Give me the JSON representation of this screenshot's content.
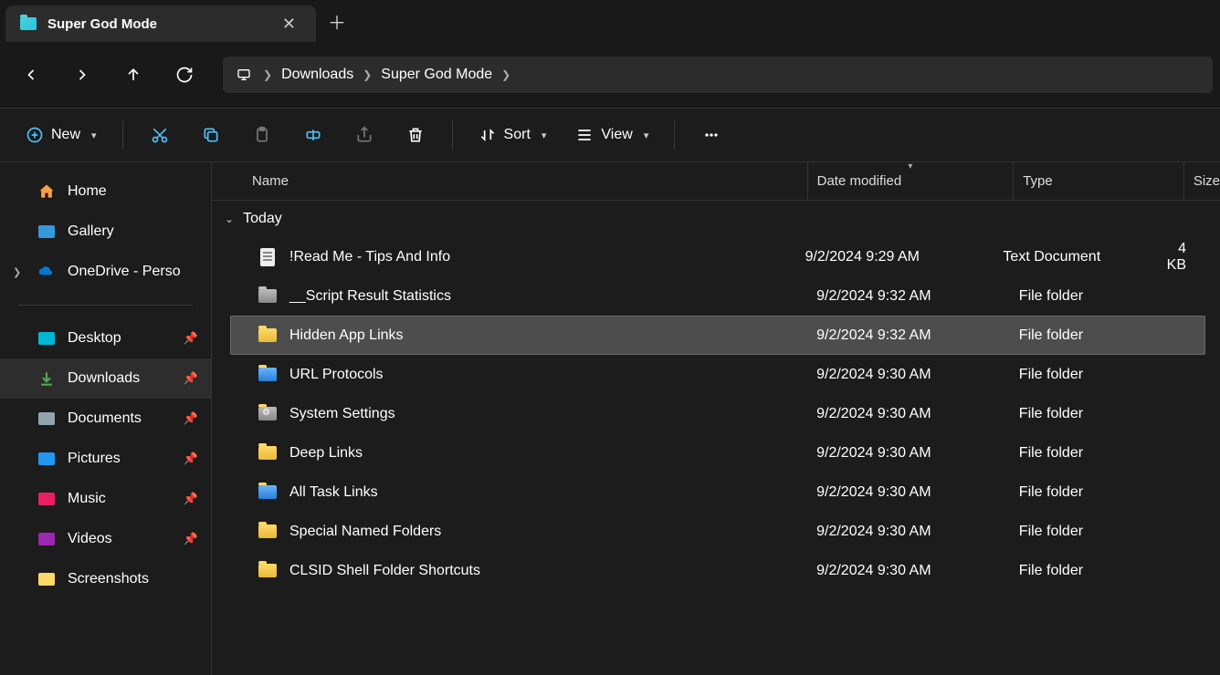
{
  "tab": {
    "title": "Super God Mode"
  },
  "breadcrumb": {
    "parts": [
      "Downloads",
      "Super God Mode"
    ]
  },
  "toolbar": {
    "new_label": "New",
    "sort_label": "Sort",
    "view_label": "View"
  },
  "columns": {
    "name": "Name",
    "date": "Date modified",
    "type": "Type",
    "size": "Size"
  },
  "sidebar": {
    "top": [
      {
        "label": "Home",
        "icon": "home"
      },
      {
        "label": "Gallery",
        "icon": "gallery"
      },
      {
        "label": "OneDrive - Perso",
        "icon": "onedrive",
        "expandable": true
      }
    ],
    "quick": [
      {
        "label": "Desktop",
        "icon": "desktop",
        "pinned": true
      },
      {
        "label": "Downloads",
        "icon": "downloads",
        "pinned": true,
        "selected": true
      },
      {
        "label": "Documents",
        "icon": "documents",
        "pinned": true
      },
      {
        "label": "Pictures",
        "icon": "pictures",
        "pinned": true
      },
      {
        "label": "Music",
        "icon": "music",
        "pinned": true
      },
      {
        "label": "Videos",
        "icon": "videos",
        "pinned": true
      },
      {
        "label": "Screenshots",
        "icon": "folder",
        "pinned": false
      }
    ]
  },
  "group": {
    "label": "Today"
  },
  "files": [
    {
      "name": "!Read Me - Tips And Info",
      "date": "9/2/2024 9:29 AM",
      "type": "Text Document",
      "size": "4 KB",
      "icon": "text"
    },
    {
      "name": "__Script Result Statistics",
      "date": "9/2/2024 9:32 AM",
      "type": "File folder",
      "size": "",
      "icon": "folder-gray"
    },
    {
      "name": "Hidden App Links",
      "date": "9/2/2024 9:32 AM",
      "type": "File folder",
      "size": "",
      "icon": "folder",
      "selected": true
    },
    {
      "name": "URL Protocols",
      "date": "9/2/2024 9:30 AM",
      "type": "File folder",
      "size": "",
      "icon": "folder-blue"
    },
    {
      "name": "System Settings",
      "date": "9/2/2024 9:30 AM",
      "type": "File folder",
      "size": "",
      "icon": "folder-gear"
    },
    {
      "name": "Deep Links",
      "date": "9/2/2024 9:30 AM",
      "type": "File folder",
      "size": "",
      "icon": "folder"
    },
    {
      "name": "All Task Links",
      "date": "9/2/2024 9:30 AM",
      "type": "File folder",
      "size": "",
      "icon": "folder-blue"
    },
    {
      "name": "Special Named Folders",
      "date": "9/2/2024 9:30 AM",
      "type": "File folder",
      "size": "",
      "icon": "folder"
    },
    {
      "name": "CLSID Shell Folder Shortcuts",
      "date": "9/2/2024 9:30 AM",
      "type": "File folder",
      "size": "",
      "icon": "folder"
    }
  ]
}
